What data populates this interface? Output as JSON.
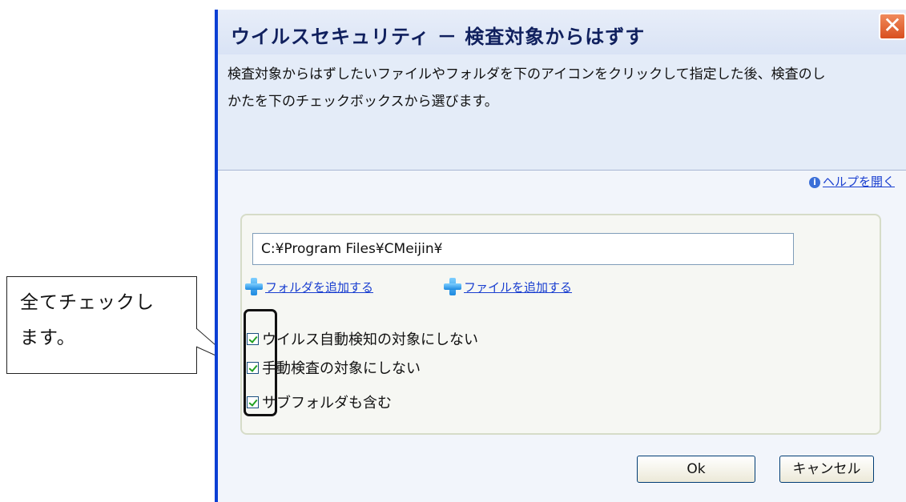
{
  "annotation": {
    "line1": "全てチェックし",
    "line2": "ます。"
  },
  "dialog": {
    "title": "ウイルスセキュリティ － 検査対象からはずす",
    "close_label": "✕",
    "description_line1": "検査対象からはずしたいファイルやフォルダを下のアイコンをクリックして指定した後、検査のし",
    "description_line2": "かたを下のチェックボックスから選びます。",
    "help_label": "ヘルプを開く",
    "help_icon": "info-icon",
    "path_value": "C:¥Program Files¥CMeijin¥",
    "add_folder_label": "フォルダを追加する",
    "add_file_label": "ファイルを追加する",
    "options": [
      {
        "label": "ウイルス自動検知の対象にしない",
        "checked": true
      },
      {
        "label": "手動検査の対象にしない",
        "checked": true
      },
      {
        "label": "サブフォルダも含む",
        "checked": true
      }
    ],
    "ok_label": "Ok",
    "cancel_label": "キャンセル"
  },
  "colors": {
    "window_border": "#0a3fd4",
    "link": "#1a3fd0",
    "check": "#21a121"
  }
}
